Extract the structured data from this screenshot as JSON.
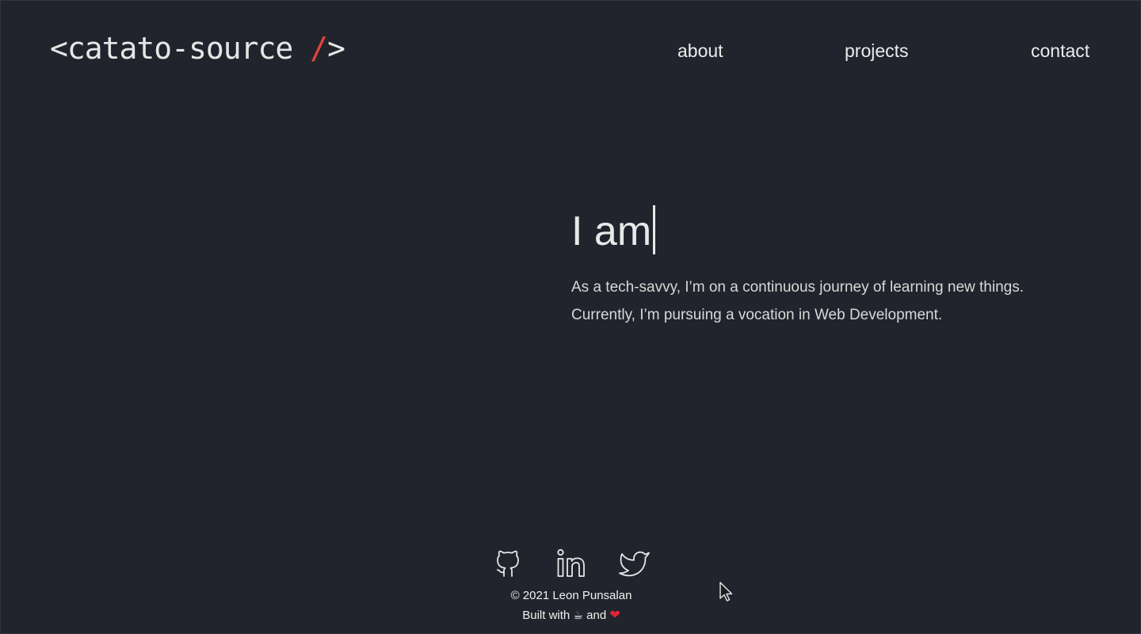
{
  "header": {
    "logo_prefix": "<catato-source ",
    "logo_slash": "/",
    "logo_suffix": ">",
    "nav": {
      "about": "about",
      "projects": "projects",
      "contact": "contact"
    }
  },
  "hero": {
    "title": "I am",
    "line1": "As a tech-savvy, I’m on a continuous journey of learning new things.",
    "line2": "Currently, I’m pursuing a vocation in Web Development."
  },
  "social": [
    {
      "icon": "github-icon"
    },
    {
      "icon": "linkedin-icon"
    },
    {
      "icon": "twitter-icon"
    }
  ],
  "footer": {
    "copyright": "© 2021 Leon Punsalan",
    "built_prefix": "Built with",
    "built_coffee": "☕",
    "built_and": "and",
    "built_heart": "❤"
  },
  "colors": {
    "background": "#21242c",
    "text": "#e6e6e6",
    "accent": "#e0453f"
  }
}
